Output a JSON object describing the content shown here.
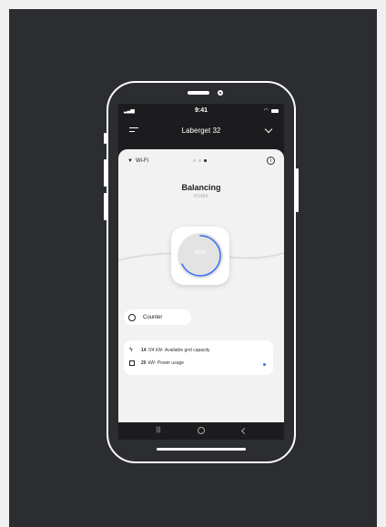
{
  "status_bar": {
    "time": "9:41"
  },
  "header": {
    "location": "Laberget 32"
  },
  "card": {
    "wifi_label": "Wi-Fi",
    "mode_title": "Balancing",
    "mode_subtitle": "HOME",
    "gauge": {
      "percent": 68,
      "label": "68%"
    },
    "counter_label": "Counter",
    "stats": [
      {
        "value": "14",
        "unit_prefix": "/24 kW",
        "text": " - Available grid capacity"
      },
      {
        "value": "20",
        "unit_prefix": " kW",
        "text": " - Power usage"
      }
    ]
  },
  "colors": {
    "accent": "#3a6ff0",
    "background": "#2b2d30"
  }
}
